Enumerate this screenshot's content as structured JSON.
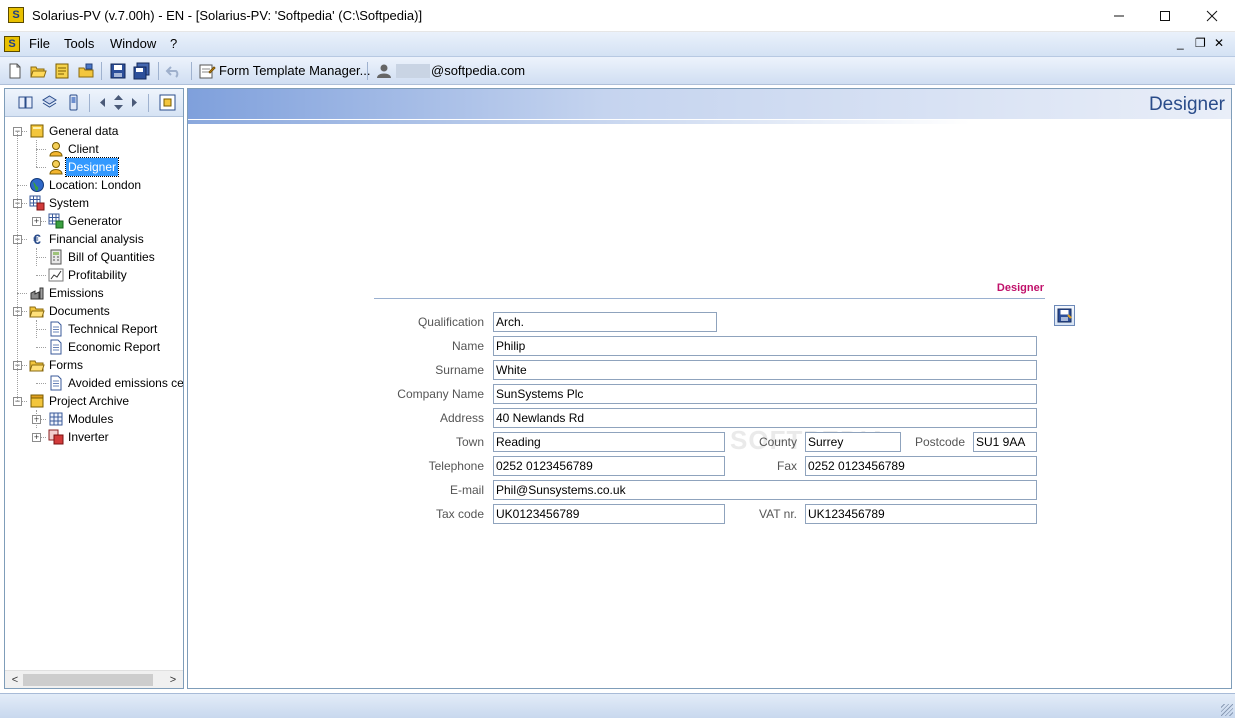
{
  "window": {
    "title": "Solarius-PV (v.7.00h) - EN - [Solarius-PV: 'Softpedia' (C:\\Softpedia)]",
    "app_icon_glyph": "S"
  },
  "menu": {
    "items": [
      "File",
      "Tools",
      "Window",
      "?"
    ],
    "mdi": {
      "minimize": "_",
      "restore": "❐",
      "close": "✕"
    }
  },
  "toolbar": {
    "form_template_label": "Form Template Manager...",
    "user_email": "@softpedia.com"
  },
  "nav_toolbar": {
    "icons": [
      "book-icon",
      "layers-icon",
      "phone-icon",
      "arrow-left-icon",
      "arrows-updown-icon",
      "arrow-right-icon",
      "frame-icon"
    ]
  },
  "tree": {
    "items": [
      {
        "label": "General data",
        "icon": "folder-yellow-icon",
        "level": 0,
        "expander": "−"
      },
      {
        "label": "Client",
        "icon": "person-icon",
        "level": 1
      },
      {
        "label": "Designer",
        "icon": "person-icon",
        "level": 1,
        "selected": true
      },
      {
        "label": "Location: London",
        "icon": "globe-icon",
        "level": 0
      },
      {
        "label": "System",
        "icon": "system-grid-icon",
        "level": 0,
        "expander": "−"
      },
      {
        "label": "Generator",
        "icon": "generator-icon",
        "level": 1,
        "expander": "+"
      },
      {
        "label": "Financial analysis",
        "icon": "euro-icon",
        "level": 0,
        "expander": "−"
      },
      {
        "label": "Bill of Quantities",
        "icon": "calculator-icon",
        "level": 1
      },
      {
        "label": "Profitability",
        "icon": "chart-icon",
        "level": 1
      },
      {
        "label": "Emissions",
        "icon": "factory-icon",
        "level": 0
      },
      {
        "label": "Documents",
        "icon": "folder-open-icon",
        "level": 0,
        "expander": "−"
      },
      {
        "label": "Technical Report",
        "icon": "document-icon",
        "level": 1
      },
      {
        "label": "Economic Report",
        "icon": "document-icon",
        "level": 1
      },
      {
        "label": "Forms",
        "icon": "folder-open-icon",
        "level": 0,
        "expander": "−"
      },
      {
        "label": "Avoided emissions certif",
        "icon": "document-icon",
        "level": 1
      },
      {
        "label": "Project Archive",
        "icon": "archive-icon",
        "level": 0,
        "expander": "−"
      },
      {
        "label": "Modules",
        "icon": "module-grid-icon",
        "level": 1,
        "expander": "+"
      },
      {
        "label": "Inverter",
        "icon": "inverter-icon",
        "level": 1,
        "expander": "+"
      }
    ]
  },
  "main": {
    "page_title": "Designer",
    "form_title": "Designer",
    "watermark": "SOFTPEDIA",
    "fields": {
      "qualification": {
        "label": "Qualification",
        "value": "Arch."
      },
      "name": {
        "label": "Name",
        "value": "Philip"
      },
      "surname": {
        "label": "Surname",
        "value": "White"
      },
      "company": {
        "label": "Company Name",
        "value": "SunSystems Plc"
      },
      "address": {
        "label": "Address",
        "value": "40 Newlands Rd"
      },
      "town": {
        "label": "Town",
        "value": "Reading"
      },
      "county": {
        "label": "County",
        "value": "Surrey"
      },
      "postcode": {
        "label": "Postcode",
        "value": "SU1 9AA"
      },
      "telephone": {
        "label": "Telephone",
        "value": "0252 0123456789"
      },
      "fax": {
        "label": "Fax",
        "value": "0252 0123456789"
      },
      "email": {
        "label": "E-mail",
        "value": "Phil@Sunsystems.co.uk"
      },
      "taxcode": {
        "label": "Tax code",
        "value": "UK0123456789"
      },
      "vat": {
        "label": "VAT nr.",
        "value": "UK123456789"
      }
    }
  },
  "colors": {
    "accent_blue": "#2a4c8a",
    "form_title_magenta": "#c0106a",
    "selection": "#3399ff"
  }
}
